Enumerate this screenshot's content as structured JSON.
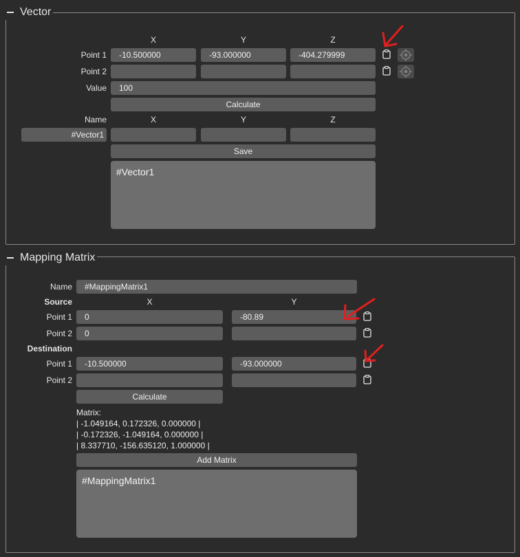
{
  "vector": {
    "title": "Vector",
    "col_x": "X",
    "col_y": "Y",
    "col_z": "Z",
    "point1_label": "Point 1",
    "point1_x": "-10.500000",
    "point1_y": "-93.000000",
    "point1_z": "-404.279999",
    "point2_label": "Point 2",
    "point2_x": "",
    "point2_y": "",
    "point2_z": "",
    "value_label": "Value",
    "value": "100",
    "calculate_label": "Calculate",
    "name_label": "Name",
    "name_x": "X",
    "name_y": "Y",
    "name_z": "Z",
    "name_value": "#Vector1",
    "result_x": "",
    "result_y": "",
    "result_z": "",
    "save_label": "Save",
    "output_text": "#Vector1"
  },
  "mapping": {
    "title": "Mapping Matrix",
    "name_label": "Name",
    "name_value": "#MappingMatrix1",
    "source_label": "Source",
    "col_x": "X",
    "col_y": "Y",
    "src_p1_label": "Point 1",
    "src_p1_x": "0",
    "src_p1_y": "-80.89",
    "src_p2_label": "Point 2",
    "src_p2_x": "0",
    "src_p2_y": "",
    "destination_label": "Destination",
    "dst_p1_label": "Point 1",
    "dst_p1_x": "-10.500000",
    "dst_p1_y": "-93.000000",
    "dst_p2_label": "Point 2",
    "dst_p2_x": "",
    "dst_p2_y": "",
    "calculate_label": "Calculate",
    "matrix_label": "Matrix:",
    "matrix_row1": "| -1.049164, 0.172326, 0.000000 |",
    "matrix_row2": "| -0.172326, -1.049164, 0.000000 |",
    "matrix_row3": "| 8.337710, -156.635120, 1.000000 |",
    "add_matrix_label": "Add Matrix",
    "output_text": "#MappingMatrix1"
  },
  "icons": {
    "clipboard": "clipboard-icon",
    "target": "target-icon",
    "annotation": "red-arrow-annotation"
  },
  "colors": {
    "background": "#2b2b2b",
    "field": "#5c5c5c",
    "output_area": "#6e6e6e",
    "annotation": "#e0201e"
  }
}
